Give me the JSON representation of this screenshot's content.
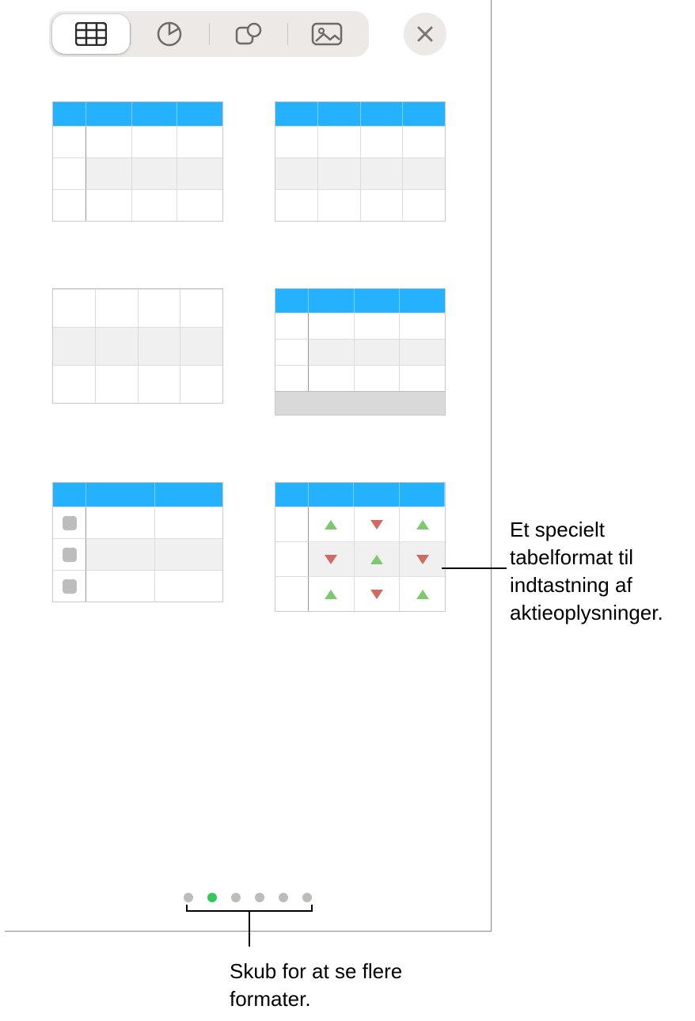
{
  "toolbar": {
    "tabs": [
      {
        "name": "table",
        "selected": true
      },
      {
        "name": "chart",
        "selected": false
      },
      {
        "name": "shape",
        "selected": false
      },
      {
        "name": "media",
        "selected": false
      }
    ]
  },
  "table_styles": [
    {
      "id": "header-leftcol",
      "desc": "Blue header row with left header column"
    },
    {
      "id": "header-only",
      "desc": "Blue header row"
    },
    {
      "id": "plain",
      "desc": "Plain grid with no header"
    },
    {
      "id": "header-leftcol-footer",
      "desc": "Blue header, left column, footer row"
    },
    {
      "id": "checklist",
      "desc": "Blue header with checkbox left column"
    },
    {
      "id": "stock",
      "desc": "Blue header with stock up/down arrows"
    }
  ],
  "pagination": {
    "count": 6,
    "active_index": 1
  },
  "callouts": {
    "stock": "Et specielt tabelformat til indtastning af aktieoplysninger.",
    "swipe": "Skub for at se flere formater."
  }
}
